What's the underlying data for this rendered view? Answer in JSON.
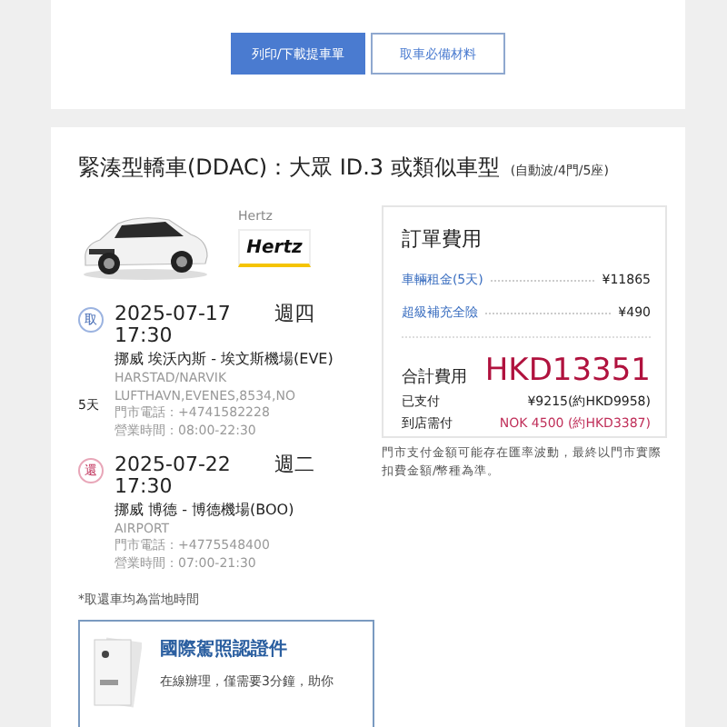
{
  "actions": [
    {
      "label": "列印/下載提車單",
      "kind": "primary"
    },
    {
      "label": "取車必備材料",
      "kind": "secondary"
    }
  ],
  "car": {
    "title": "緊湊型轎車(DDAC)：大眾 ID.3 或類似車型",
    "specs": "(自動波/4門/5座)",
    "vendor": "Hertz",
    "logo": "Hertz"
  },
  "pickup": {
    "badge": "取",
    "date": "2025-07-17",
    "weekday": "週四",
    "time": "17:30",
    "location": "挪威 埃沃內斯 - 埃文斯機場(EVE)",
    "address": [
      "HARSTAD/NARVIK",
      "LUFTHAVN,EVENES,8534,NO"
    ],
    "phone": "門市電話：+4741582228",
    "hours": "營業時間：08:00-22:30"
  },
  "duration": "5天",
  "dropoff": {
    "badge": "還",
    "date": "2025-07-22",
    "weekday": "週二",
    "time": "17:30",
    "location": "挪威 博德 - 博德機場(BOO)",
    "address": [
      "AIRPORT"
    ],
    "phone": "門市電話：+4775548400",
    "hours": "營業時間：07:00-21:30"
  },
  "time_note": "*取還車均為當地時間",
  "promo": {
    "title": "國際駕照認證件",
    "text": "在線辦理，僅需要3分鐘，助你"
  },
  "fees": {
    "title": "訂單費用",
    "items": [
      {
        "label": "車輛租金(5天)",
        "amount": "¥11865"
      },
      {
        "label": "超級補充全險",
        "amount": "¥490"
      }
    ],
    "total_label": "合計費用",
    "total": "HKD13351",
    "paid_label": "已支付",
    "paid": "¥9215(約HKD9958)",
    "due_label": "到店需付",
    "due": "NOK 4500 (約HKD3387)"
  },
  "fee_note": "門市支付金額可能存在匯率波動，最終以門市實際扣費金額/幣種為準。"
}
